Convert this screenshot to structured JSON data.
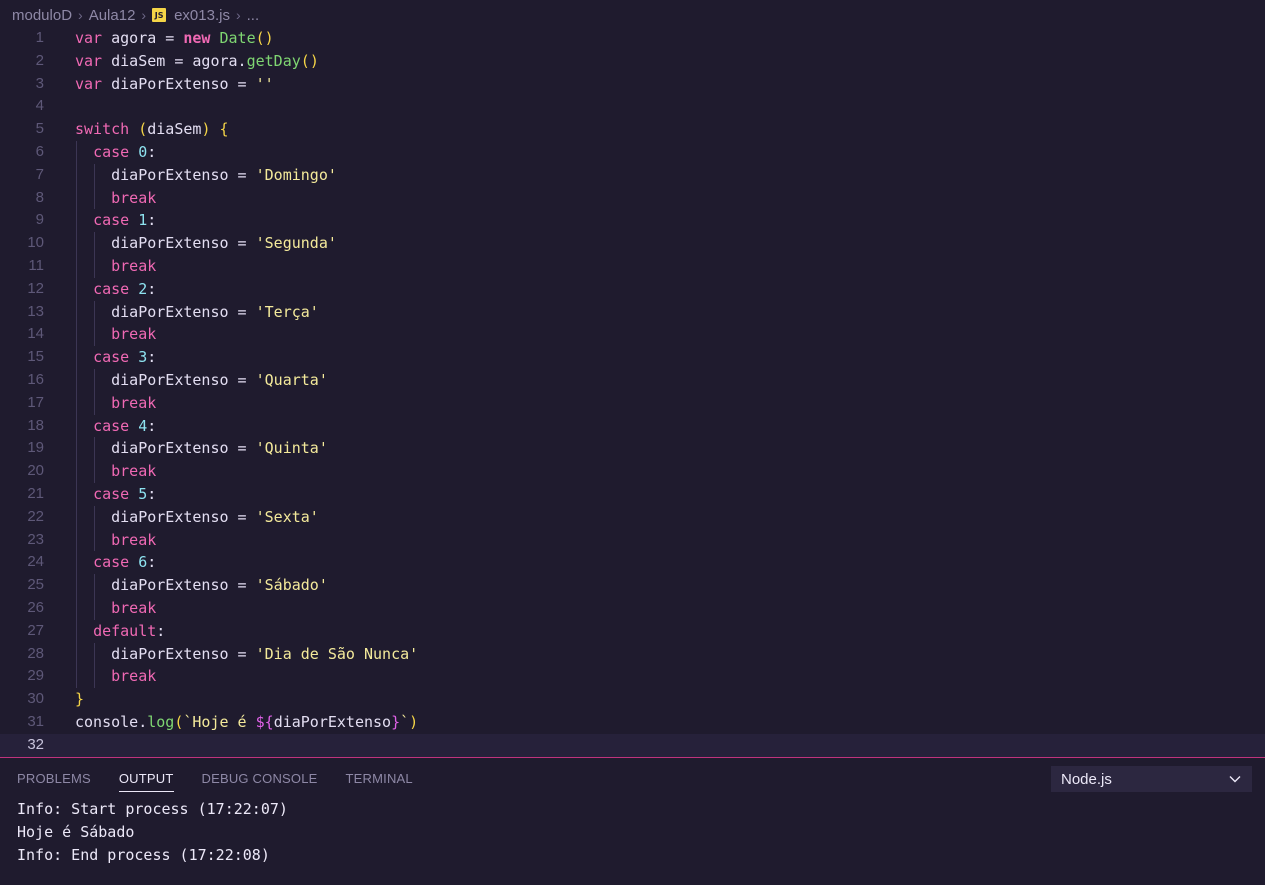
{
  "breadcrumb": {
    "folder1": "moduloD",
    "folder2": "Aula12",
    "file_icon": "JS",
    "file": "ex013.js",
    "more": "..."
  },
  "code_lines": [
    "var agora = new Date()",
    "var diaSem = agora.getDay()",
    "var diaPorExtenso = ''",
    "",
    "switch (diaSem) {",
    "  case 0:",
    "    diaPorExtenso = 'Domingo'",
    "    break",
    "  case 1:",
    "    diaPorExtenso = 'Segunda'",
    "    break",
    "  case 2:",
    "    diaPorExtenso = 'Terça'",
    "    break",
    "  case 3:",
    "    diaPorExtenso = 'Quarta'",
    "    break",
    "  case 4:",
    "    diaPorExtenso = 'Quinta'",
    "    break",
    "  case 5:",
    "    diaPorExtenso = 'Sexta'",
    "    break",
    "  case 6:",
    "    diaPorExtenso = 'Sábado'",
    "    break",
    "  default:",
    "    diaPorExtenso = 'Dia de São Nunca'",
    "    break",
    "}",
    "console.log(`Hoje é ${diaPorExtenso}`)",
    ""
  ],
  "active_line": 32,
  "panel": {
    "tabs": [
      "PROBLEMS",
      "OUTPUT",
      "DEBUG CONSOLE",
      "TERMINAL"
    ],
    "active_tab": "OUTPUT",
    "output_channel": "Node.js",
    "output_lines": [
      "Info: Start process (17:22:07)",
      "Hoje é Sábado",
      "Info: End process (17:22:08)"
    ]
  },
  "colors": {
    "background": "#1f1b2e",
    "keyword": "#f069b4",
    "function": "#7fd672",
    "string": "#f4ea9b",
    "number": "#8ee3f0",
    "bracket": "#f5d547",
    "panel_accent": "#c0337d"
  }
}
